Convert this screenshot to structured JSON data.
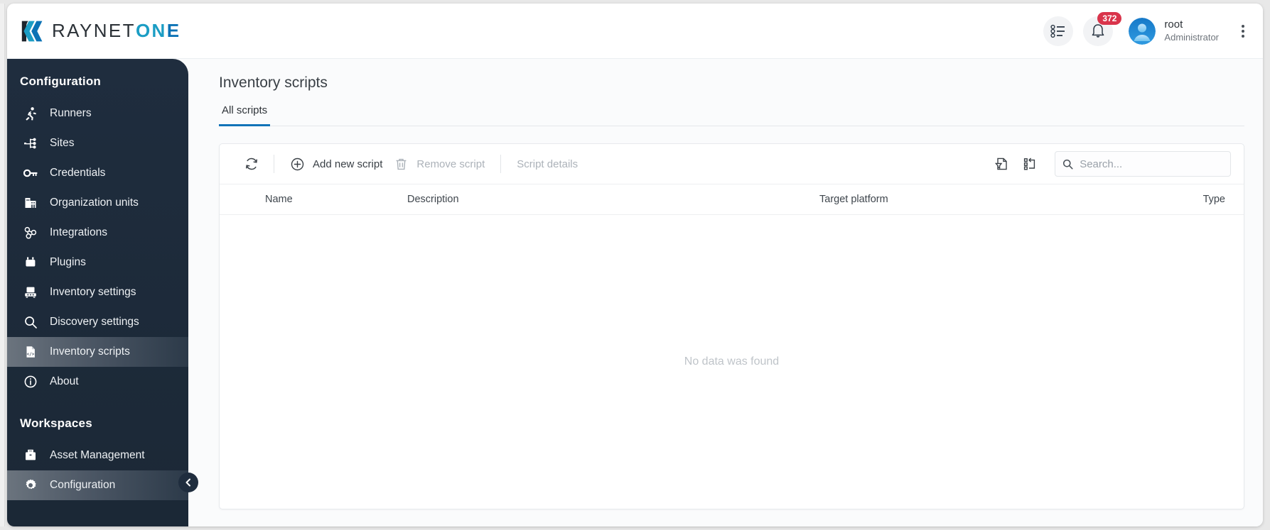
{
  "brand": {
    "logo_text_dark": "RAYNET",
    "logo_text_on": "ON",
    "logo_text_e": "E",
    "accent_blue": "#1173b8",
    "accent_teal": "#1b9dc4",
    "sidebar_bg": "#1f2d3e",
    "badge_red": "#d9344b"
  },
  "topbar": {
    "tasks_icon": "list-checklist-icon",
    "notifications_icon": "bell-icon",
    "notification_count": "372",
    "avatar_icon": "user-avatar-icon",
    "user_name": "root",
    "user_role": "Administrator",
    "overflow_icon": "kebab-menu-icon"
  },
  "sidebar": {
    "group_one_title": "Configuration",
    "group_two_title": "Workspaces",
    "items": [
      {
        "label": "Runners",
        "icon": "runner-icon",
        "active": false
      },
      {
        "label": "Sites",
        "icon": "sitemap-icon",
        "active": false
      },
      {
        "label": "Credentials",
        "icon": "key-icon",
        "active": false
      },
      {
        "label": "Organization units",
        "icon": "building-icon",
        "active": false
      },
      {
        "label": "Integrations",
        "icon": "integrations-icon",
        "active": false
      },
      {
        "label": "Plugins",
        "icon": "plug-briefcase-icon",
        "active": false
      },
      {
        "label": "Inventory settings",
        "icon": "inventory-settings-icon",
        "active": false
      },
      {
        "label": "Discovery settings",
        "icon": "magnifier-icon",
        "active": false
      },
      {
        "label": "Inventory scripts",
        "icon": "script-file-icon",
        "active": true
      },
      {
        "label": "About",
        "icon": "info-circle-icon",
        "active": false
      }
    ],
    "workspaces": [
      {
        "label": "Asset Management",
        "icon": "briefcase-icon",
        "active": false
      },
      {
        "label": "Configuration",
        "icon": "gear-icon",
        "active": true
      }
    ],
    "collapse_icon": "chevron-left-icon"
  },
  "main": {
    "page_title": "Inventory scripts",
    "tabs": [
      {
        "label": "All scripts",
        "active": true
      }
    ],
    "toolbar": {
      "refresh_icon": "refresh-icon",
      "add_icon": "plus-circle-icon",
      "add_label": "Add new script",
      "remove_icon": "trash-icon",
      "remove_label": "Remove script",
      "details_label": "Script details",
      "export_icon": "export-file-icon",
      "columns_icon": "column-layout-icon"
    },
    "search": {
      "icon": "search-icon",
      "value": "",
      "placeholder": "Search..."
    },
    "table": {
      "columns": [
        "Name",
        "Description",
        "Target platform",
        "Type"
      ],
      "rows": [],
      "empty_message": "No data was found"
    }
  }
}
